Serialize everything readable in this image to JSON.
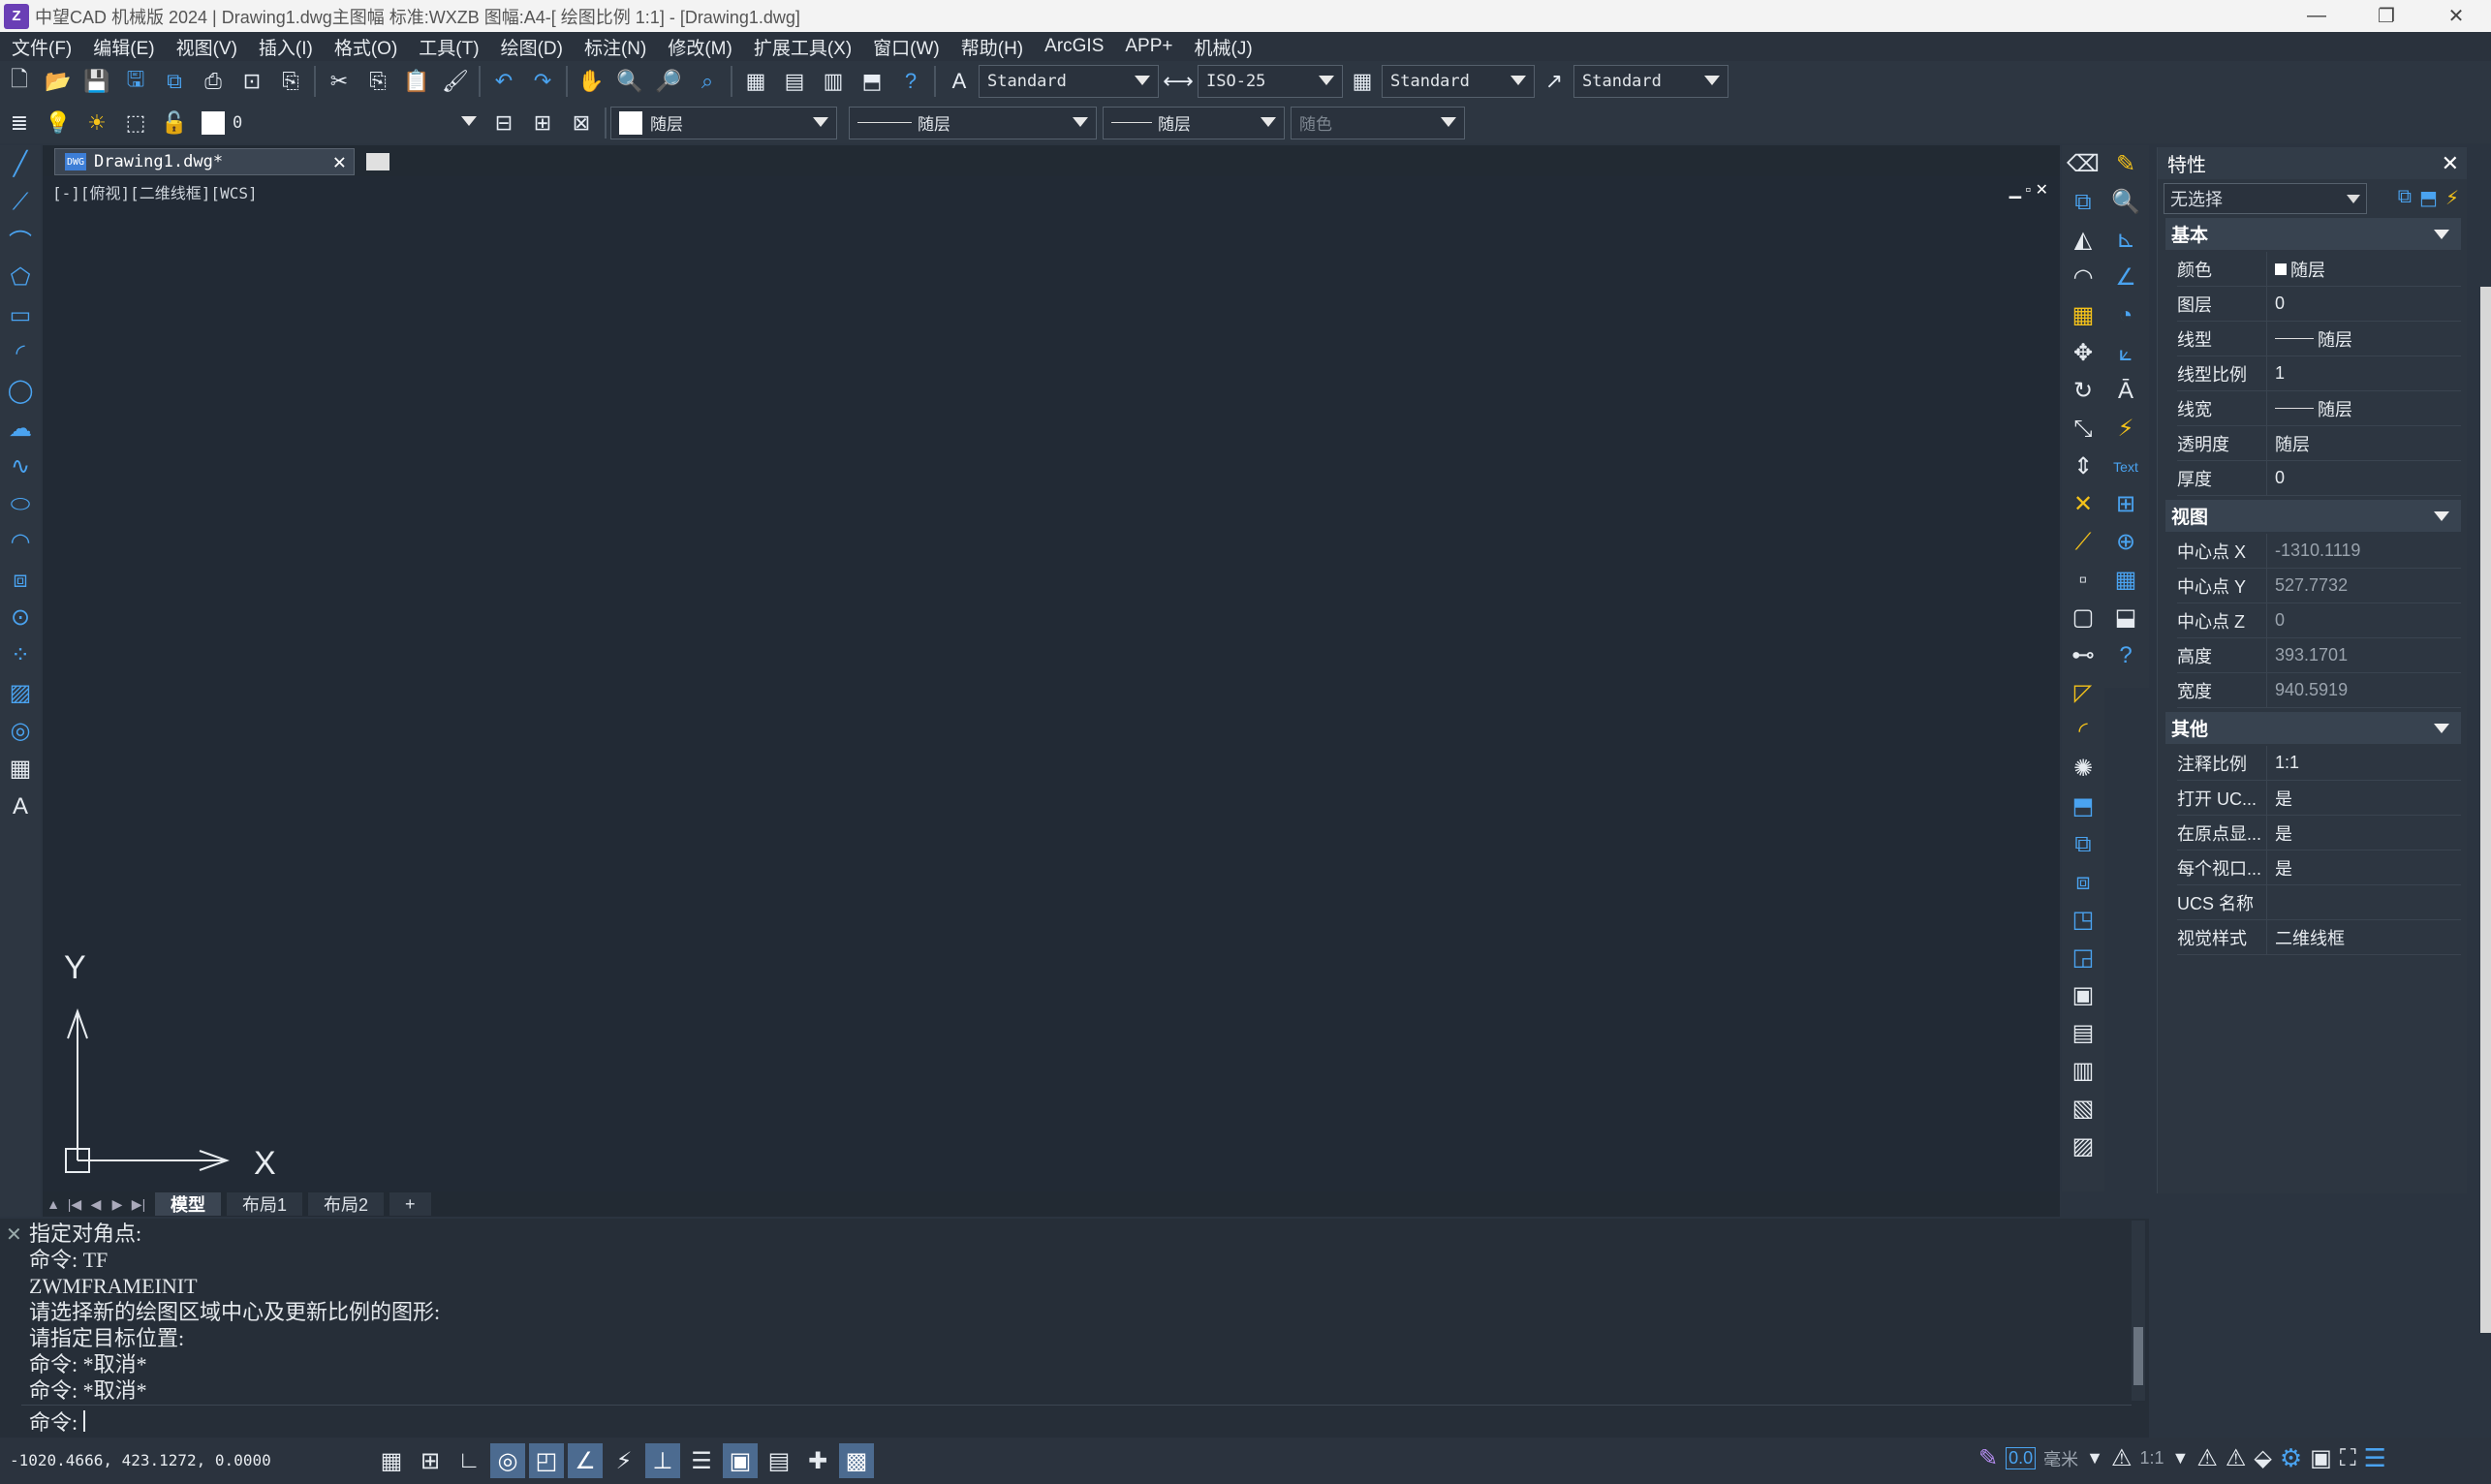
{
  "window": {
    "logo": "Z",
    "title": "中望CAD 机械版 2024 | Drawing1.dwg主图幅  标准:WXZB 图幅:A4-[ 绘图比例 1:1] - [Drawing1.dwg]",
    "minimize": "—",
    "restore": "❐",
    "close": "✕"
  },
  "menu": [
    "文件(F)",
    "编辑(E)",
    "视图(V)",
    "插入(I)",
    "格式(O)",
    "工具(T)",
    "绘图(D)",
    "标注(N)",
    "修改(M)",
    "扩展工具(X)",
    "窗口(W)",
    "帮助(H)",
    "ArcGIS",
    "APP+",
    "机械(J)"
  ],
  "toolbar": {
    "text_style": "Standard",
    "dim_style": "ISO-25",
    "table_style": "Standard",
    "mleader_style": "Standard",
    "layer": "0",
    "color": "随层",
    "linetype": "随层",
    "lineweight": "随层",
    "plotstyle": "随色"
  },
  "document": {
    "tab_name": "Drawing1.dwg*",
    "tab_icon": "DWG",
    "close": "✕",
    "viewport_label": "[-][俯视][二维线框][WCS]",
    "viewport_controls": "▁ ▫ ✕"
  },
  "ucs": {
    "x_label": "X",
    "y_label": "Y"
  },
  "layout_tabs": [
    "模型",
    "布局1",
    "布局2",
    "+"
  ],
  "layout_nav": [
    "▲",
    "|◀",
    "◀",
    "▶",
    "▶|"
  ],
  "properties": {
    "title": "特性",
    "close": "✕",
    "selection": "无选择",
    "basic": {
      "label": "基本",
      "rows": [
        {
          "k": "颜色",
          "v": "随层"
        },
        {
          "k": "图层",
          "v": "0"
        },
        {
          "k": "线型",
          "v": "随层"
        },
        {
          "k": "线型比例",
          "v": "1"
        },
        {
          "k": "线宽",
          "v": "随层"
        },
        {
          "k": "透明度",
          "v": "随层"
        },
        {
          "k": "厚度",
          "v": "0"
        }
      ]
    },
    "view": {
      "label": "视图",
      "rows": [
        {
          "k": "中心点 X",
          "v": "-1310.1119"
        },
        {
          "k": "中心点 Y",
          "v": "527.7732"
        },
        {
          "k": "中心点 Z",
          "v": "0"
        },
        {
          "k": "高度",
          "v": "393.1701"
        },
        {
          "k": "宽度",
          "v": "940.5919"
        }
      ]
    },
    "other": {
      "label": "其他",
      "rows": [
        {
          "k": "注释比例",
          "v": "1:1"
        },
        {
          "k": "打开 UC...",
          "v": "是"
        },
        {
          "k": "在原点显...",
          "v": "是"
        },
        {
          "k": "每个视口...",
          "v": "是"
        },
        {
          "k": "UCS 名称",
          "v": ""
        },
        {
          "k": "视觉样式",
          "v": "二维线框"
        }
      ]
    }
  },
  "command": {
    "history": [
      "指定对角点:",
      "命令: TF",
      "ZWMFRAMEINIT",
      "请选择新的绘图区域中心及更新比例的图形:",
      "请指定目标位置:",
      "命令: *取消*",
      "命令: *取消*"
    ],
    "prompt": "命令:"
  },
  "status": {
    "coords": "-1020.4666, 423.1272, 0.0000",
    "units_value": "0.0",
    "units": "毫米",
    "scale": "1:1"
  },
  "right_icon_text": "Text"
}
